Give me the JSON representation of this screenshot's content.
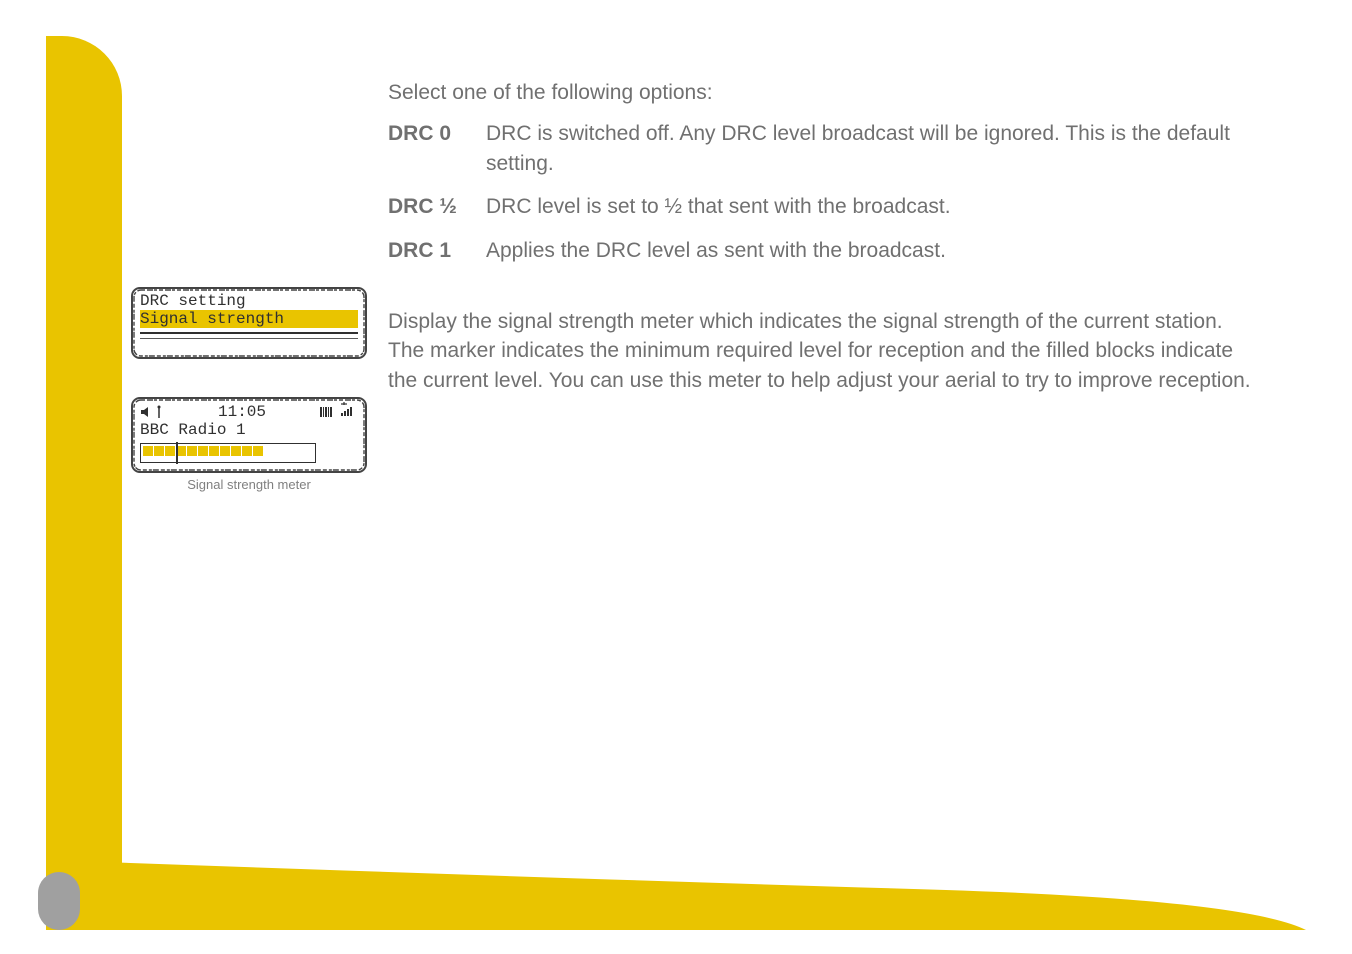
{
  "intro": "Select one of the following options:",
  "options": [
    {
      "name": "DRC 0",
      "desc": "DRC is switched off. Any DRC level broadcast will be ignored. This is the default setting."
    },
    {
      "name": "DRC ½",
      "desc": "DRC level is set to ½ that sent with the broadcast."
    },
    {
      "name": "DRC 1",
      "desc": "Applies the DRC level as sent with the broadcast."
    }
  ],
  "para2": "Display the signal strength meter which indicates the signal strength of the current station. The marker indicates the minimum required level for reception and the filled blocks indicate the current level. You can use this meter to help adjust your aerial to try to improve reception.",
  "lcd1": {
    "line1": "DRC setting",
    "line2": "Signal strength"
  },
  "lcd2": {
    "time": "11:05",
    "station": "BBC Radio 1",
    "caption": "Signal strength meter",
    "meter_filled": 11,
    "meter_total": 14,
    "marker_index": 3
  }
}
